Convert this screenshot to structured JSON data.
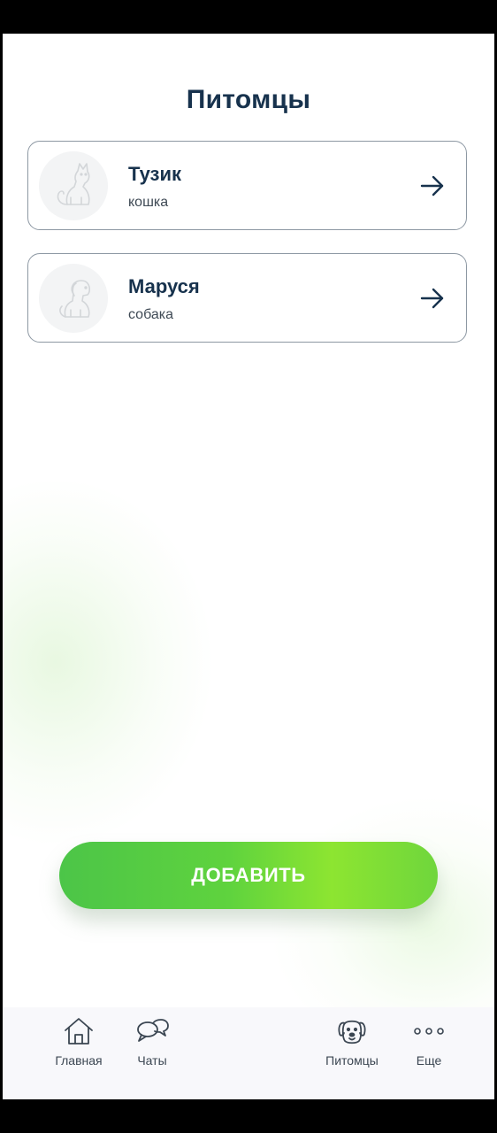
{
  "page": {
    "title": "Питомцы",
    "accent_color": "#17324d",
    "button_gradient": [
      "#4cc548",
      "#8de531"
    ]
  },
  "pets": [
    {
      "name": "Тузик",
      "type": "кошка",
      "avatar_icon": "cat-icon",
      "action_icon": "arrow-right-icon"
    },
    {
      "name": "Маруся",
      "type": "собака",
      "avatar_icon": "dog-icon",
      "action_icon": "arrow-right-icon"
    }
  ],
  "add_button": {
    "label": "ДОБАВИТЬ"
  },
  "tabbar": {
    "items": [
      {
        "label": "Главная",
        "icon": "home-icon"
      },
      {
        "label": "Чаты",
        "icon": "chat-icon"
      },
      {
        "label": "Питомцы",
        "icon": "dog-face-icon"
      },
      {
        "label": "Еще",
        "icon": "more-icon"
      }
    ]
  }
}
